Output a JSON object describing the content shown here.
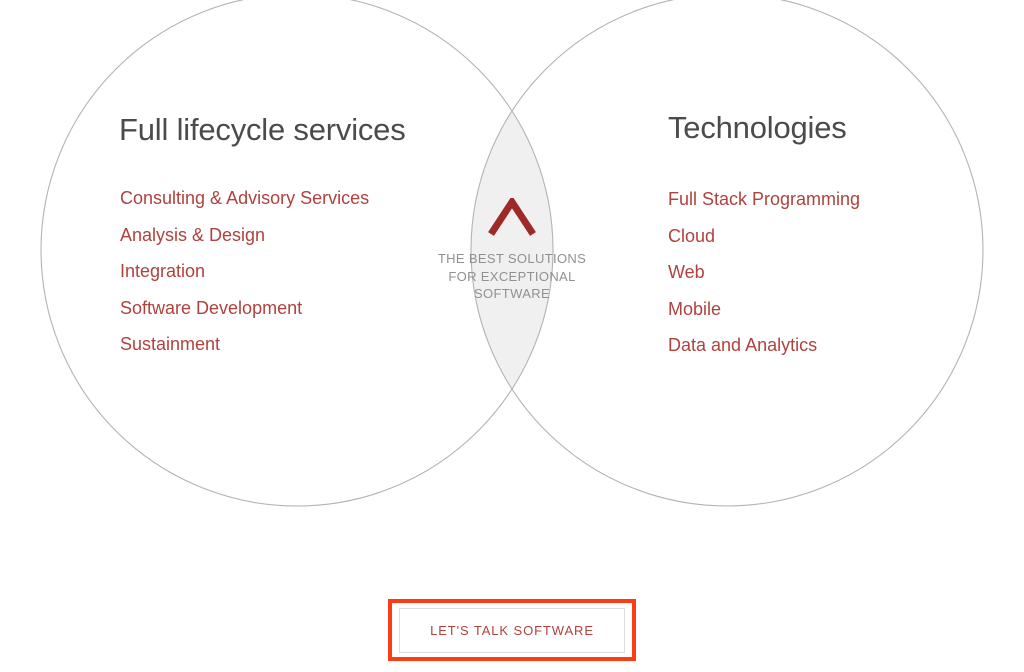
{
  "page": {
    "background_color": "#ffffff"
  },
  "colors": {
    "heading": "#4b4b4b",
    "accent_red": "#b0423e",
    "chevron_red": "#9e2a28",
    "circle_stroke": "#b3b3b3",
    "lens_fill": "#f0f0f0",
    "caption_gray": "#919191",
    "highlight_orange": "#fc3d14",
    "button_border": "#dcdcdc"
  },
  "venn": {
    "left_circle": {
      "heading": "Full lifecycle services",
      "items": [
        "Consulting & Advisory Services",
        "Analysis & Design",
        "Integration",
        "Software Development",
        "Sustainment"
      ]
    },
    "right_circle": {
      "heading": "Technologies",
      "items": [
        "Full Stack Programming",
        "Cloud",
        "Web",
        "Mobile",
        "Data and Analytics"
      ]
    },
    "intersection": {
      "icon": "chevron-up-icon",
      "caption_lines": [
        "THE BEST SOLUTIONS",
        "FOR EXCEPTIONAL",
        "SOFTWARE"
      ]
    }
  },
  "cta": {
    "label": "LET'S TALK SOFTWARE"
  }
}
